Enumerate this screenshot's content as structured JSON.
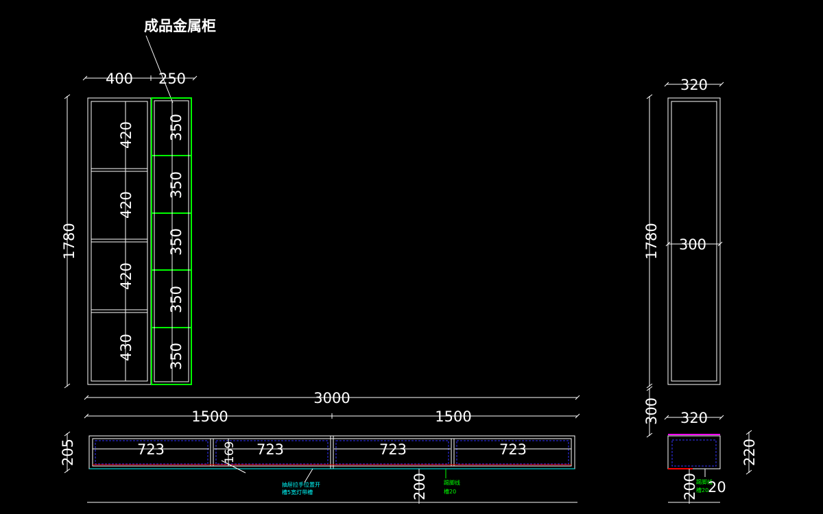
{
  "title": "成品金属柜",
  "colors": {
    "background": "#000000",
    "line": "#ffffff",
    "cabinet": "#00ff00",
    "hidden": "#3333ff",
    "cyan_note": "#00ffff",
    "green_note": "#00ff00",
    "magenta": "#ff00ff",
    "red": "#ff0000"
  },
  "front": {
    "width_left": "400",
    "width_right": "250",
    "height_total": "1780",
    "left_bays": [
      "420",
      "420",
      "420",
      "430"
    ],
    "right_bays": [
      "350",
      "350",
      "350",
      "350",
      "350"
    ]
  },
  "side": {
    "depth_outer": "320",
    "depth_inner": "300",
    "height_total": "1780"
  },
  "base": {
    "length_total": "3000",
    "halves": [
      "1500",
      "1500"
    ],
    "drawers": [
      "723",
      "723",
      "723",
      "723"
    ],
    "height": "205",
    "rail_height": "169",
    "floor_gap": "200",
    "note_cyan": [
      "抽屉拉手位置开",
      "槽5宽灯带槽"
    ],
    "note_green": [
      "踢脚线",
      "槽20"
    ]
  },
  "base_side": {
    "depth": "320",
    "plinth_height": "300",
    "height": "220",
    "floor_gap": "200",
    "small_dim": "20",
    "note": [
      "踢脚线",
      "槽20"
    ]
  }
}
